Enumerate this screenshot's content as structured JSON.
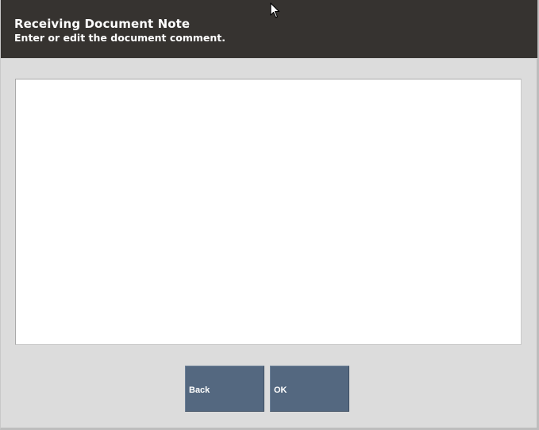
{
  "header": {
    "title": "Receiving Document Note",
    "subtitle": "Enter or edit the document comment."
  },
  "note": {
    "value": ""
  },
  "buttons": {
    "back_label": "Back",
    "ok_label": "OK"
  },
  "colors": {
    "header_bg": "#363330",
    "button_bg": "#546880",
    "dialog_bg": "#dcdcdc"
  },
  "icons": {
    "cursor": "mouse-pointer-icon"
  }
}
